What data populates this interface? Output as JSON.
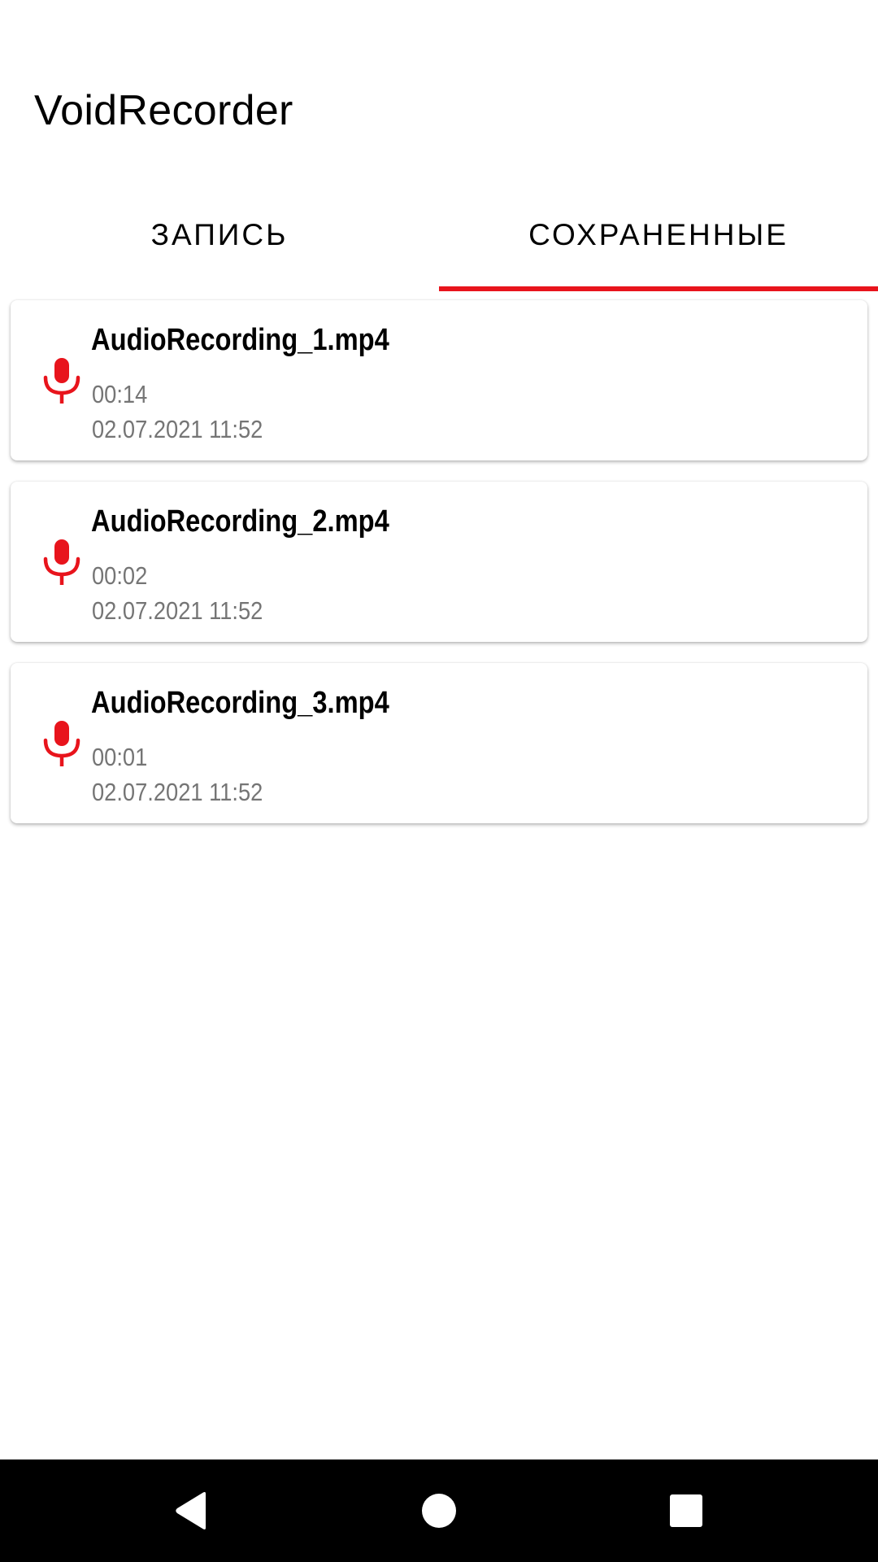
{
  "app": {
    "title": "VoidRecorder"
  },
  "tabs": [
    {
      "label": "ЗАПИСЬ",
      "selected": false
    },
    {
      "label": "СОХРАНЕННЫЕ",
      "selected": true
    }
  ],
  "colors": {
    "accent": "#e8141c",
    "secondary_text": "#757575"
  },
  "recordings": [
    {
      "name": "AudioRecording_1.mp4",
      "duration": "00:14",
      "date": "02.07.2021 11:52",
      "icon": "mic-icon"
    },
    {
      "name": "AudioRecording_2.mp4",
      "duration": "00:02",
      "date": "02.07.2021 11:52",
      "icon": "mic-icon"
    },
    {
      "name": "AudioRecording_3.mp4",
      "duration": "00:01",
      "date": "02.07.2021 11:52",
      "icon": "mic-icon"
    }
  ],
  "navigation": {
    "back": "back-icon",
    "home": "home-icon",
    "recents": "recents-icon"
  }
}
